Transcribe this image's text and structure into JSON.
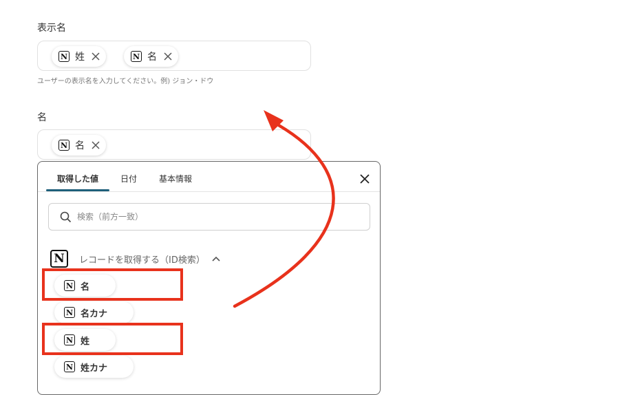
{
  "display_name": {
    "label": "表示名",
    "chips": [
      {
        "label": "姓"
      },
      {
        "label": "名"
      }
    ],
    "hint": "ユーザーの表示名を入力してください。例) ジョン・ドウ"
  },
  "first_name": {
    "label": "名",
    "chips": [
      {
        "label": "名"
      }
    ]
  },
  "picker": {
    "tabs": [
      {
        "label": "取得した値",
        "active": true
      },
      {
        "label": "日付",
        "active": false
      },
      {
        "label": "基本情報",
        "active": false
      }
    ],
    "search_placeholder": "検索（前方一致）",
    "section_title": "レコードを取得する（ID検索）",
    "items": [
      {
        "label": "名",
        "highlighted": true
      },
      {
        "label": "名カナ",
        "highlighted": false
      },
      {
        "label": "姓",
        "highlighted": true
      },
      {
        "label": "姓カナ",
        "highlighted": false
      }
    ]
  },
  "colors": {
    "highlight": "#e8321c",
    "arrow": "#e8321c",
    "tab_underline": "#1e5f7a"
  },
  "icons": [
    "notion-icon",
    "close-icon",
    "search-icon",
    "chevron-up-icon",
    "arrow-annotation"
  ]
}
